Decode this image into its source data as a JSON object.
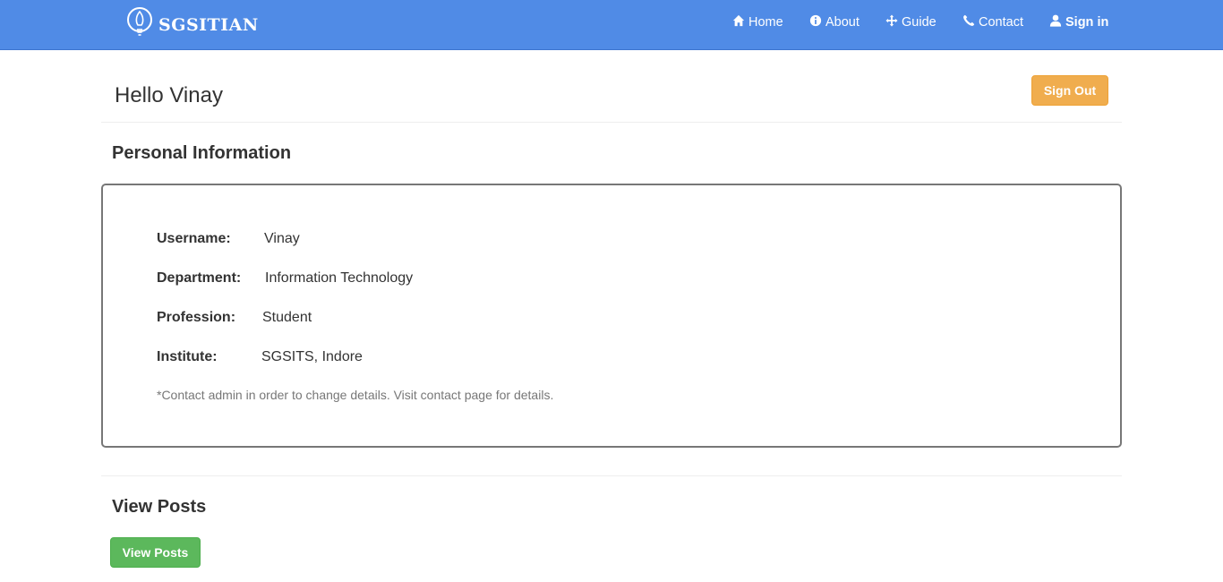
{
  "navbar": {
    "brand": "SGSITIAN",
    "items": [
      {
        "label": "Home",
        "icon": "home-icon"
      },
      {
        "label": "About",
        "icon": "info-icon"
      },
      {
        "label": "Guide",
        "icon": "move-icon"
      },
      {
        "label": "Contact",
        "icon": "phone-icon"
      },
      {
        "label": "Sign in",
        "icon": "user-icon"
      }
    ],
    "background": "#508be6"
  },
  "header": {
    "greeting": "Hello Vinay",
    "sign_out_label": "Sign Out",
    "sign_out_color": "#f0ad4e"
  },
  "personal_info": {
    "title": "Personal Information",
    "fields": [
      {
        "label": "Username:",
        "value": "Vinay"
      },
      {
        "label": "Department:",
        "value": "Information Technology"
      },
      {
        "label": "Profession:",
        "value": "Student"
      },
      {
        "label": "Institute:",
        "value": "SGSITS, Indore"
      }
    ],
    "note": "*Contact admin in order to change details. Visit contact page for details."
  },
  "posts": {
    "title": "View Posts",
    "button_label": "View Posts",
    "button_color": "#5cb85c"
  }
}
